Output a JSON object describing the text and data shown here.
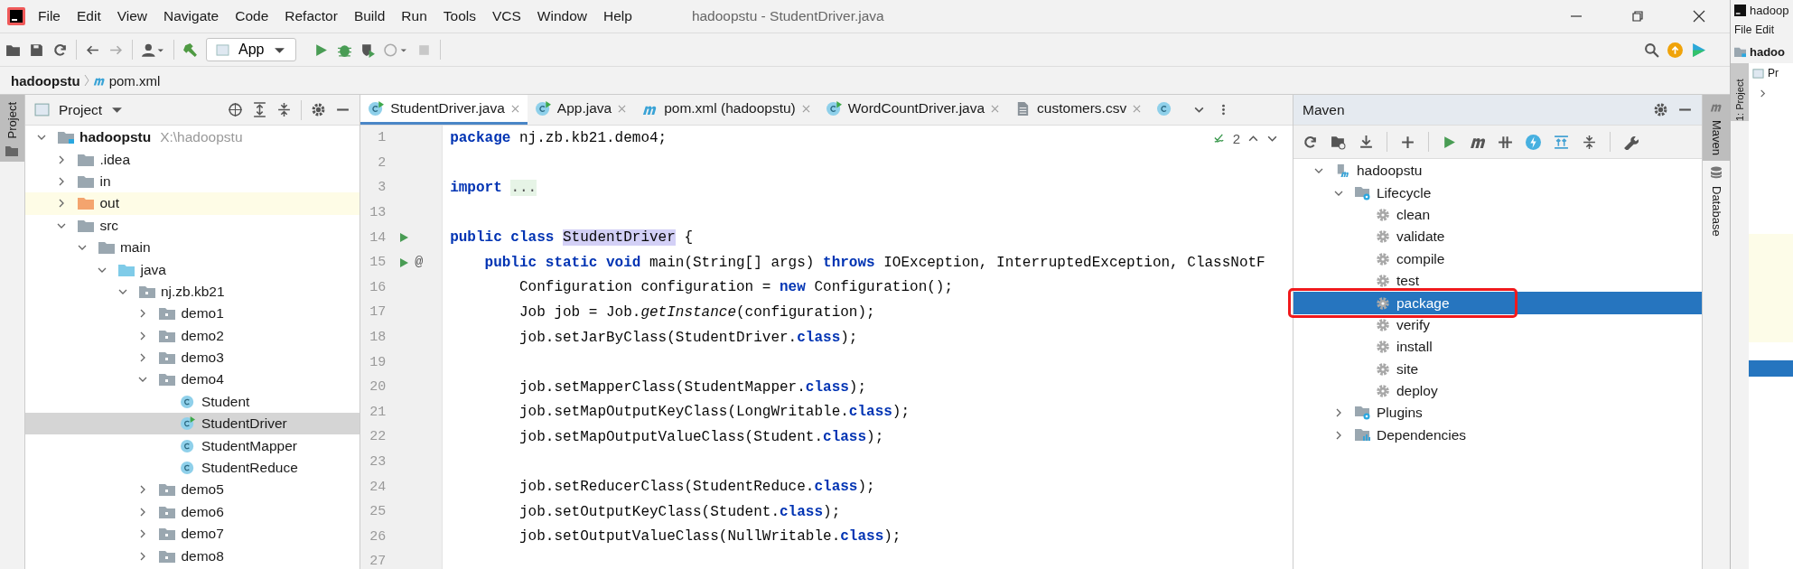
{
  "window": {
    "title": "hadoopstu - StudentDriver.java"
  },
  "menu": [
    "File",
    "Edit",
    "View",
    "Navigate",
    "Code",
    "Refactor",
    "Build",
    "Run",
    "Tools",
    "VCS",
    "Window",
    "Help"
  ],
  "toolbar": {
    "run_config": "App"
  },
  "breadcrumb": [
    "hadoopstu",
    "pom.xml"
  ],
  "left_tool_strip": [
    {
      "label": "Project",
      "selected": true
    }
  ],
  "project": {
    "title": "Project",
    "tree": [
      {
        "label": "hadoopstu",
        "path": "X:\\hadoopstu",
        "kind": "module",
        "expanded": true,
        "selected": false,
        "children": [
          {
            "label": ".idea",
            "kind": "folder",
            "expanded": false,
            "selected": false
          },
          {
            "label": "in",
            "kind": "folder",
            "expanded": false,
            "selected": false
          },
          {
            "label": "out",
            "kind": "excluded",
            "expanded": false,
            "selected": false
          },
          {
            "label": "src",
            "kind": "folder",
            "expanded": true,
            "selected": false,
            "children": [
              {
                "label": "main",
                "kind": "folder",
                "expanded": true,
                "selected": false,
                "children": [
                  {
                    "label": "java",
                    "kind": "source",
                    "expanded": true,
                    "selected": false,
                    "children": [
                      {
                        "label": "nj.zb.kb21",
                        "kind": "package",
                        "expanded": true,
                        "selected": false,
                        "children": [
                          {
                            "label": "demo1",
                            "kind": "package",
                            "expanded": false,
                            "selected": false
                          },
                          {
                            "label": "demo2",
                            "kind": "package",
                            "expanded": false,
                            "selected": false
                          },
                          {
                            "label": "demo3",
                            "kind": "package",
                            "expanded": false,
                            "selected": false
                          },
                          {
                            "label": "demo4",
                            "kind": "package",
                            "expanded": true,
                            "selected": false,
                            "children": [
                              {
                                "label": "Student",
                                "kind": "class",
                                "selected": false
                              },
                              {
                                "label": "StudentDriver",
                                "kind": "main-class",
                                "selected": true
                              },
                              {
                                "label": "StudentMapper",
                                "kind": "class",
                                "selected": false
                              },
                              {
                                "label": "StudentReduce",
                                "kind": "class",
                                "selected": false
                              }
                            ]
                          },
                          {
                            "label": "demo5",
                            "kind": "package",
                            "expanded": false,
                            "selected": false
                          },
                          {
                            "label": "demo6",
                            "kind": "package",
                            "expanded": false,
                            "selected": false
                          },
                          {
                            "label": "demo7",
                            "kind": "package",
                            "expanded": false,
                            "selected": false
                          },
                          {
                            "label": "demo8",
                            "kind": "package",
                            "expanded": false,
                            "selected": false
                          }
                        ]
                      }
                    ]
                  }
                ]
              }
            ]
          }
        ]
      }
    ]
  },
  "tabs": [
    {
      "label": "StudentDriver.java",
      "kind": "main-class",
      "selected": true
    },
    {
      "label": "App.java",
      "kind": "main-class",
      "selected": false
    },
    {
      "label": "pom.xml (hadoopstu)",
      "kind": "maven",
      "selected": false
    },
    {
      "label": "WordCountDriver.java",
      "kind": "main-class",
      "selected": false
    },
    {
      "label": "customers.csv",
      "kind": "csv",
      "selected": false
    },
    {
      "kind": "class",
      "selected": false
    }
  ],
  "editor": {
    "inspections": "2",
    "lines": [
      {
        "number": "1",
        "code": "**package** nj.zb.kb21.demo4;"
      },
      {
        "number": "2"
      },
      {
        "number": "3",
        "code": "**import** ",
        "folded": "..."
      },
      {
        "number": "13"
      },
      {
        "number": "14",
        "runnable": true,
        "code": "**public class** ",
        "highlight": "StudentDriver",
        "after": " {"
      },
      {
        "number": "15",
        "runnable": true,
        "marker": "@",
        "code": "    **public static void** main(String[] args) **throws** IOException, InterruptedException, ClassNotF"
      },
      {
        "number": "16",
        "code": "        Configuration configuration = **new** Configuration();"
      },
      {
        "number": "17",
        "code": "        Job job = Job.*getInstance*(configuration);"
      },
      {
        "number": "18",
        "code": "        job.setJarByClass(StudentDriver.**class**);"
      },
      {
        "number": "19"
      },
      {
        "number": "20",
        "code": "        job.setMapperClass(StudentMapper.**class**);"
      },
      {
        "number": "21",
        "code": "        job.setMapOutputKeyClass(LongWritable.**class**);"
      },
      {
        "number": "22",
        "code": "        job.setMapOutputValueClass(Student.**class**);"
      },
      {
        "number": "23"
      },
      {
        "number": "24",
        "code": "        job.setReducerClass(StudentReduce.**class**);"
      },
      {
        "number": "25",
        "code": "        job.setOutputKeyClass(Student.**class**);"
      },
      {
        "number": "26",
        "code": "        job.setOutputValueClass(NullWritable.**class**);"
      },
      {
        "number": "27"
      }
    ]
  },
  "maven": {
    "title": "Maven",
    "tree": [
      {
        "label": "hadoopstu",
        "kind": "maven-module",
        "expanded": true,
        "selected": false,
        "children": [
          {
            "label": "Lifecycle",
            "kind": "gear-folder",
            "expanded": true,
            "selected": false,
            "children": [
              {
                "label": "clean",
                "kind": "goal",
                "selected": false
              },
              {
                "label": "validate",
                "kind": "goal",
                "selected": false
              },
              {
                "label": "compile",
                "kind": "goal",
                "selected": false
              },
              {
                "label": "test",
                "kind": "goal",
                "selected": false
              },
              {
                "label": "package",
                "kind": "goal",
                "selected": true,
                "annotated": true
              },
              {
                "label": "verify",
                "kind": "goal",
                "selected": false
              },
              {
                "label": "install",
                "kind": "goal",
                "selected": false
              },
              {
                "label": "site",
                "kind": "goal",
                "selected": false
              },
              {
                "label": "deploy",
                "kind": "goal",
                "selected": false
              }
            ]
          },
          {
            "label": "Plugins",
            "kind": "gear-folder",
            "expanded": false,
            "selected": false
          },
          {
            "label": "Dependencies",
            "kind": "deps-folder",
            "expanded": false,
            "selected": false
          }
        ]
      }
    ]
  },
  "right_tool_strip": [
    {
      "label": "Maven",
      "selected": true
    },
    {
      "label": "Database",
      "selected": false
    }
  ],
  "other_window": {
    "title": "hadoop",
    "menu": [
      "File",
      "Edit"
    ],
    "breadcrumb": "hadoo",
    "panel": "Pr",
    "tool_tab": "1: Project"
  }
}
